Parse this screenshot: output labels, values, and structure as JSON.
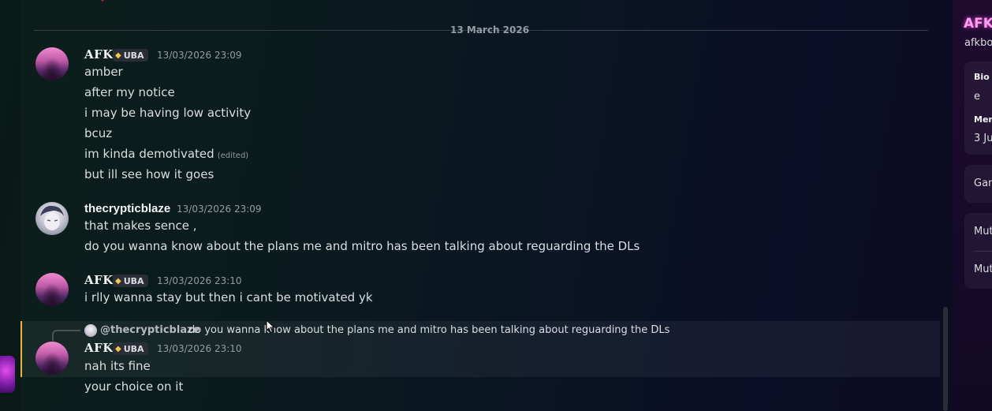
{
  "date_divider": "13 March 2026",
  "messages": [
    {
      "author": "AFK",
      "tag": "UBA",
      "timestamp": "13/03/2026 23:09",
      "lines": [
        "amber",
        "after my notice",
        "i may be having low activity",
        "bcuz",
        "im kinda demotivated",
        "but ill see how it goes"
      ],
      "edited_label": "(edited)"
    },
    {
      "author": "thecrypticblaze",
      "timestamp": "13/03/2026 23:09",
      "lines": [
        "that makes sence ,",
        "do you wanna know about the plans me and mitro has been talking about reguarding the DLs"
      ]
    },
    {
      "author": "AFK",
      "tag": "UBA",
      "timestamp": "13/03/2026 23:10",
      "lines": [
        "i rlly wanna stay but then i cant be motivated yk"
      ]
    },
    {
      "author": "AFK",
      "tag": "UBA",
      "timestamp": "13/03/2026 23:10",
      "reply": {
        "name": "@thecrypticblaze",
        "text": "do you wanna know about the plans me and mitro has been talking about reguarding the DLs"
      },
      "lines": [
        "nah its fine",
        "your choice on it"
      ]
    }
  ],
  "profile": {
    "display_name": "AFK",
    "username": "afkbo",
    "bio_label": "Bio",
    "bio_value": "e",
    "member_label": "Mem",
    "member_value": "3 Ju",
    "games_label": "Gan",
    "mutual1_label": "Mut",
    "mutual2_label": "Mut"
  },
  "colors": {
    "reply_accent": "#f0b232",
    "profile_name": "#ff9ef0",
    "tag_gem": "#f4c94a"
  },
  "icons": {
    "tag": "gem-icon",
    "reply": "reply-spine-icon"
  }
}
